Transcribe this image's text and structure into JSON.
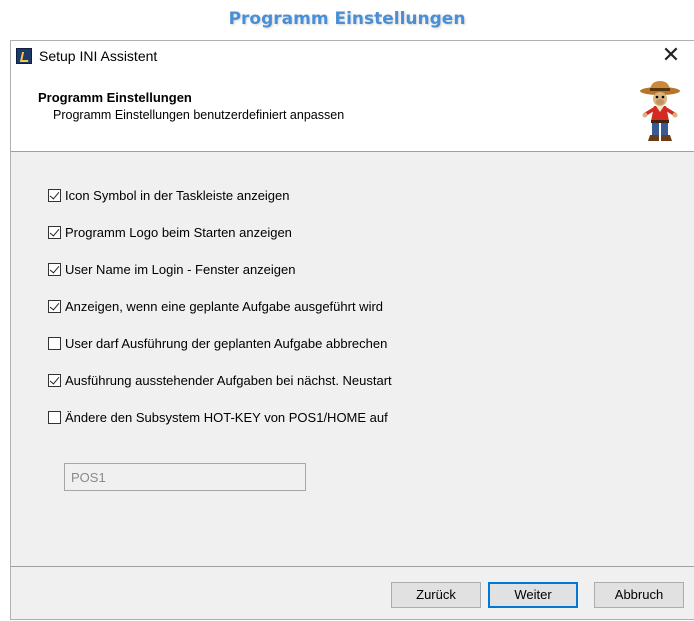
{
  "page": {
    "heading": "Programm Einstellungen"
  },
  "window": {
    "title": "Setup INI Assistent",
    "close_glyph": "✕"
  },
  "header": {
    "title": "Programm Einstellungen",
    "subtitle": "Programm Einstellungen benutzerdefiniert anpassen",
    "image_icon": "cowboy-mascot-icon"
  },
  "options": [
    {
      "label": "Icon Symbol in der Taskleiste anzeigen",
      "checked": true
    },
    {
      "label": "Programm Logo  beim Starten anzeigen",
      "checked": true
    },
    {
      "label": "User Name im Login - Fenster anzeigen",
      "checked": true
    },
    {
      "label": "Anzeigen,  wenn eine geplante Aufgabe ausgeführt wird",
      "checked": true
    },
    {
      "label": "User darf Ausführung der geplanten Aufgabe abbrechen",
      "checked": false
    },
    {
      "label": "Ausführung ausstehender Aufgaben bei nächst. Neustart",
      "checked": true
    },
    {
      "label": "Ändere den Subsystem HOT-KEY von POS1/HOME auf",
      "checked": false
    }
  ],
  "hotkey_input": {
    "value": "POS1",
    "disabled": true
  },
  "buttons": {
    "back": "Zurück",
    "next": "Weiter",
    "cancel": "Abbruch"
  },
  "colors": {
    "heading": "#4a8fd6",
    "accent": "#0078d7",
    "dialog_bg": "#f0f0f0"
  }
}
